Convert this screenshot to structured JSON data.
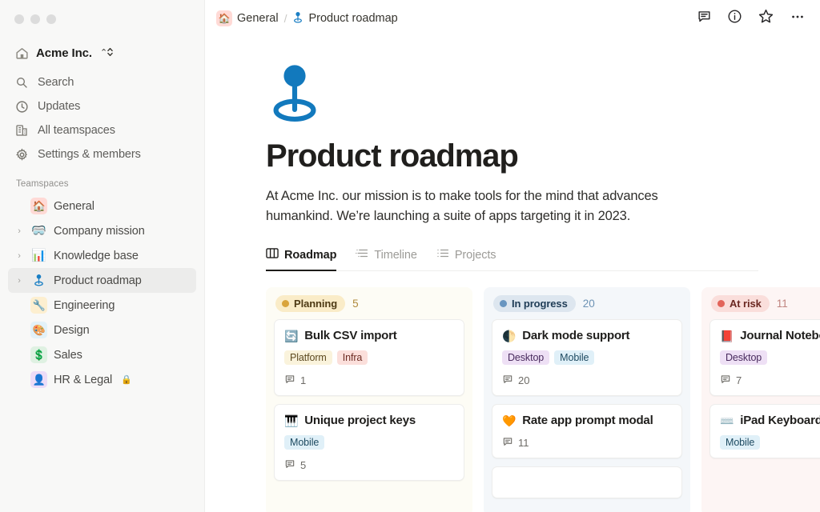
{
  "window": {
    "controls": [
      "close",
      "minimize",
      "maximize"
    ]
  },
  "sidebar": {
    "workspace": {
      "name": "Acme Inc.",
      "icon": "home-icon"
    },
    "nav": [
      {
        "label": "Search",
        "icon": "search-icon"
      },
      {
        "label": "Updates",
        "icon": "clock-icon"
      },
      {
        "label": "All teamspaces",
        "icon": "building-icon"
      },
      {
        "label": "Settings & members",
        "icon": "gear-icon"
      }
    ],
    "section_label": "Teamspaces",
    "teamspaces": [
      {
        "label": "General",
        "emoji": "🏠",
        "emoji_bg": "#ffdad6",
        "expandable": false,
        "selected": false,
        "locked": false
      },
      {
        "label": "Company mission",
        "emoji": "🥽",
        "emoji_bg": "transparent",
        "expandable": true,
        "selected": false,
        "locked": false
      },
      {
        "label": "Knowledge base",
        "emoji": "📊",
        "emoji_bg": "transparent",
        "expandable": true,
        "selected": false,
        "locked": false
      },
      {
        "label": "Product roadmap",
        "emoji": "📍",
        "emoji_bg": "transparent",
        "expandable": true,
        "selected": true,
        "locked": false
      },
      {
        "label": "Engineering",
        "emoji": "🔧",
        "emoji_bg": "#fdefd0",
        "expandable": false,
        "selected": false,
        "locked": false
      },
      {
        "label": "Design",
        "emoji": "🎨",
        "emoji_bg": "#e2f1f8",
        "expandable": false,
        "selected": false,
        "locked": false
      },
      {
        "label": "Sales",
        "emoji": "💲",
        "emoji_bg": "#dff1e2",
        "expandable": false,
        "selected": false,
        "locked": false
      },
      {
        "label": "HR & Legal",
        "emoji": "👤",
        "emoji_bg": "#ecdcf7",
        "expandable": false,
        "selected": false,
        "locked": true,
        "lock_glyph": "🔒"
      }
    ]
  },
  "topbar": {
    "breadcrumb": [
      {
        "label": "General",
        "emoji": "🏠"
      },
      {
        "label": "Product roadmap",
        "icon": "pin-icon"
      }
    ],
    "separator": "/",
    "actions": [
      {
        "name": "comments-icon"
      },
      {
        "name": "info-icon"
      },
      {
        "name": "star-icon"
      },
      {
        "name": "more-options-icon"
      }
    ]
  },
  "page": {
    "icon": "pin-icon",
    "title": "Product roadmap",
    "description": "At Acme Inc. our mission is to make tools for the mind that advances humankind. We’re launching a suite of apps targeting it in 2023."
  },
  "tabs": [
    {
      "label": "Roadmap",
      "icon": "board-icon",
      "active": true
    },
    {
      "label": "Timeline",
      "icon": "timeline-icon",
      "active": false
    },
    {
      "label": "Projects",
      "icon": "list-icon",
      "active": false
    }
  ],
  "board": {
    "columns": [
      {
        "status": "Planning",
        "count": "5",
        "theme": "planning",
        "cards": [
          {
            "emoji": "🔄",
            "title": "Bulk CSV import",
            "tags": [
              {
                "label": "Platform",
                "theme": "platform"
              },
              {
                "label": "Infra",
                "theme": "infra"
              }
            ],
            "comments": "1"
          },
          {
            "emoji": "🎹",
            "title": "Unique project keys",
            "tags": [
              {
                "label": "Mobile",
                "theme": "mobile"
              }
            ],
            "comments": "5"
          }
        ]
      },
      {
        "status": "In progress",
        "count": "20",
        "theme": "progress",
        "cards": [
          {
            "emoji": "🌓",
            "title": "Dark mode support",
            "tags": [
              {
                "label": "Desktop",
                "theme": "desktop"
              },
              {
                "label": "Mobile",
                "theme": "mobile"
              }
            ],
            "comments": "20"
          },
          {
            "emoji": "🧡",
            "title": "Rate app prompt modal",
            "tags": [],
            "comments": "11"
          },
          {
            "emoji": "",
            "title": "",
            "tags": [],
            "comments": ""
          }
        ]
      },
      {
        "status": "At risk",
        "count": "11",
        "theme": "risk",
        "cards": [
          {
            "emoji": "📕",
            "title": "Journal Notebook",
            "tags": [
              {
                "label": "Desktop",
                "theme": "desktop"
              }
            ],
            "comments": "7"
          },
          {
            "emoji": "⌨️",
            "title": "iPad Keyboard",
            "tags": [
              {
                "label": "Mobile",
                "theme": "mobile"
              }
            ],
            "comments": ""
          }
        ]
      }
    ]
  },
  "colors": {
    "accent_blue": "#1b7fc4",
    "planning": "#d9a43c",
    "in_progress": "#6895c0",
    "at_risk": "#e2645a",
    "sidebar_bg": "#f8f8f7"
  }
}
